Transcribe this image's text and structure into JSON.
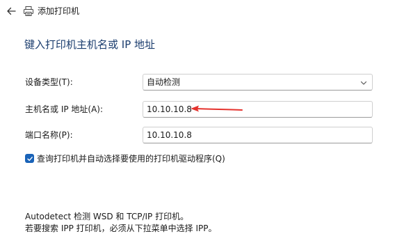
{
  "window": {
    "title": "添加打印机"
  },
  "page": {
    "heading": "键入打印机主机名或 IP 地址"
  },
  "form": {
    "device_type": {
      "label": "设备类型(T):",
      "value": "自动检测"
    },
    "hostname": {
      "label": "主机名或 IP 地址(A):",
      "value": "10.10.10.8"
    },
    "port_name": {
      "label": "端口名称(P):",
      "value": "10.10.10.8"
    },
    "query_checkbox": {
      "label": "查询打印机并自动选择要使用的打印机驱动程序(Q)",
      "checked": true
    }
  },
  "info": {
    "line1": "Autodetect 检测 WSD 和 TCP/IP 打印机。",
    "line2": "若要搜索 IPP 打印机，必须从下拉菜单中选择 IPP。"
  },
  "colors": {
    "heading": "#1b3d6e",
    "checkbox": "#1a63b8",
    "annotation_arrow": "#e5322d"
  },
  "icons": {
    "back": "back-arrow-icon",
    "printer": "printer-icon",
    "chevron": "chevron-down-icon",
    "check": "checkmark-icon"
  }
}
